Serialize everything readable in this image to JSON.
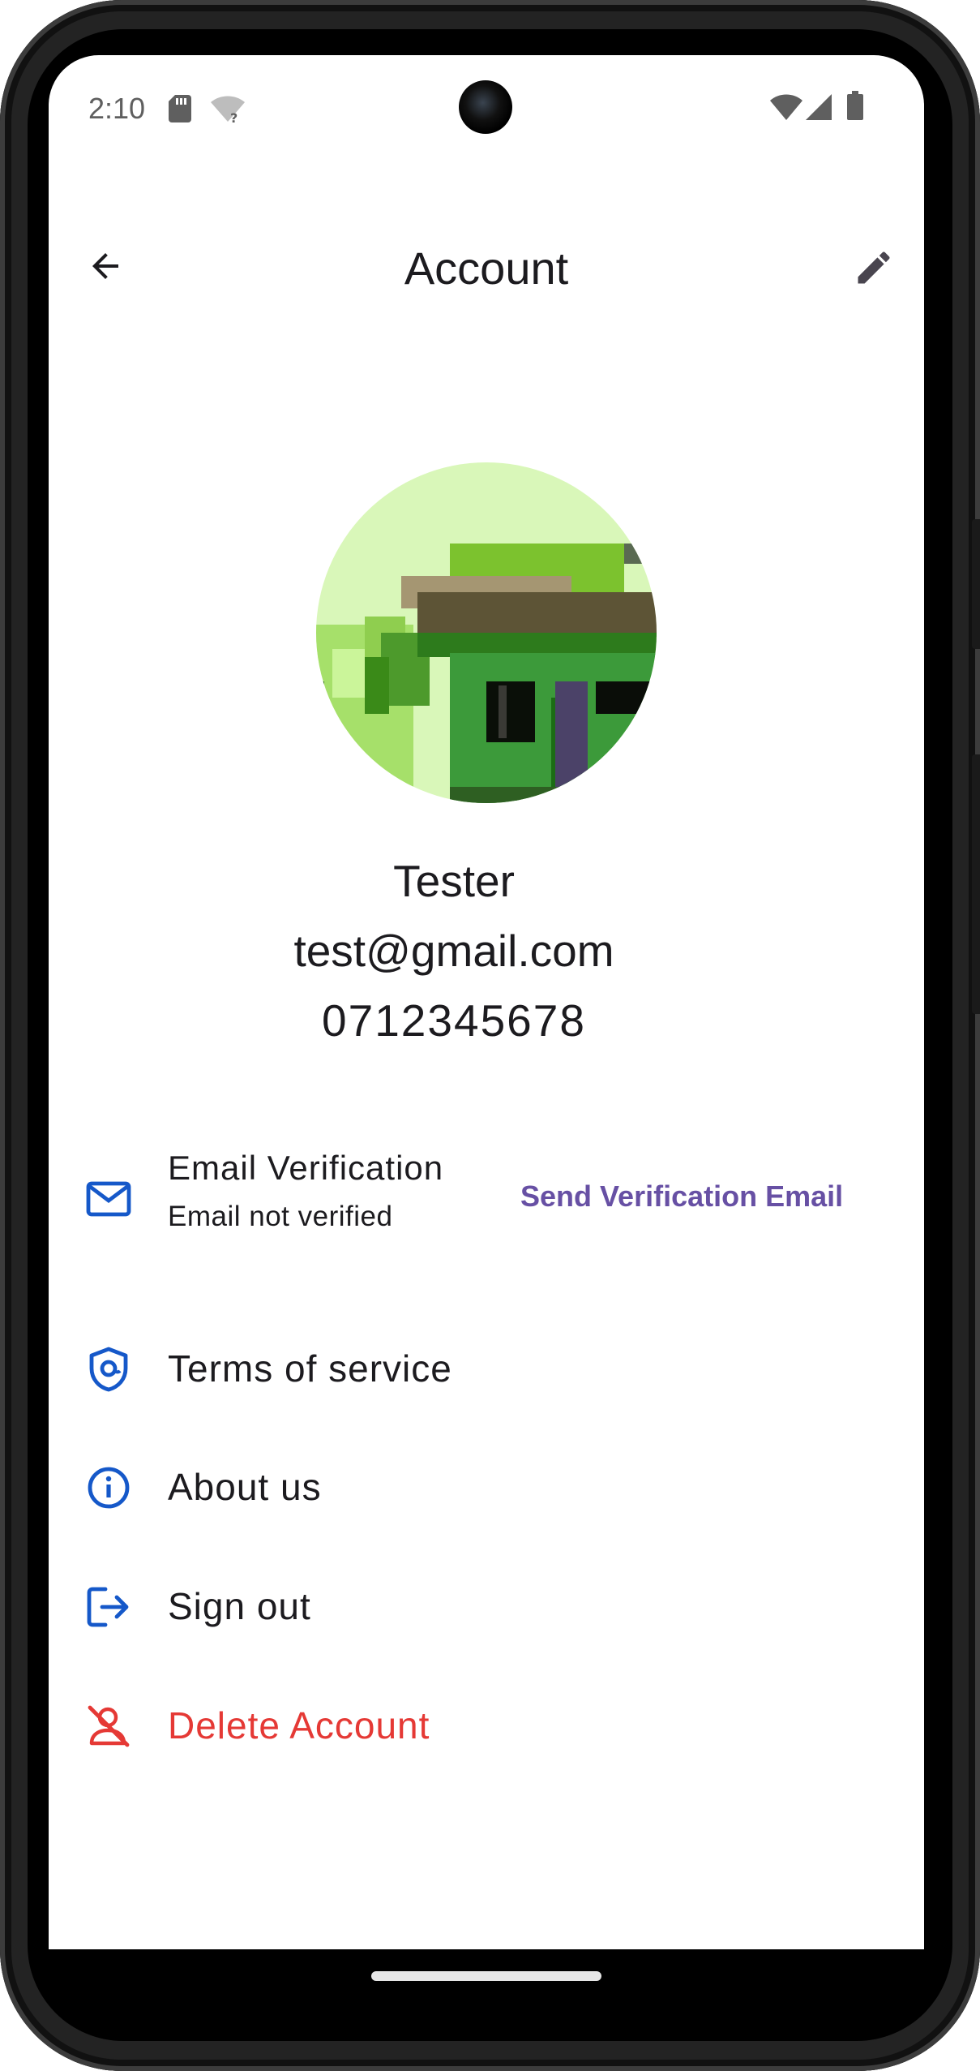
{
  "status_bar": {
    "time": "2:10",
    "icons": [
      "sd-card-icon",
      "wifi-unknown-icon",
      "wifi-icon",
      "signal-icon",
      "battery-icon"
    ]
  },
  "app_bar": {
    "title": "Account",
    "back_icon": "arrow-back-icon",
    "edit_icon": "edit-pencil-icon"
  },
  "profile": {
    "name": "Tester",
    "email": "test@gmail.com",
    "phone": "0712345678"
  },
  "menu": {
    "email_verification": {
      "label": "Email Verification",
      "status": "Email not verified",
      "action": "Send Verification Email",
      "icon": "mail-icon"
    },
    "terms": {
      "label": "Terms of service",
      "icon": "shield-icon"
    },
    "about": {
      "label": "About us",
      "icon": "info-icon"
    },
    "sign_out": {
      "label": "Sign out",
      "icon": "logout-icon"
    },
    "delete": {
      "label": "Delete Account",
      "icon": "user-off-icon"
    }
  },
  "colors": {
    "icon_blue": "#1558c9",
    "accent_purple": "#6750a4",
    "danger_red": "#e53935",
    "text": "#1c1b1f"
  }
}
